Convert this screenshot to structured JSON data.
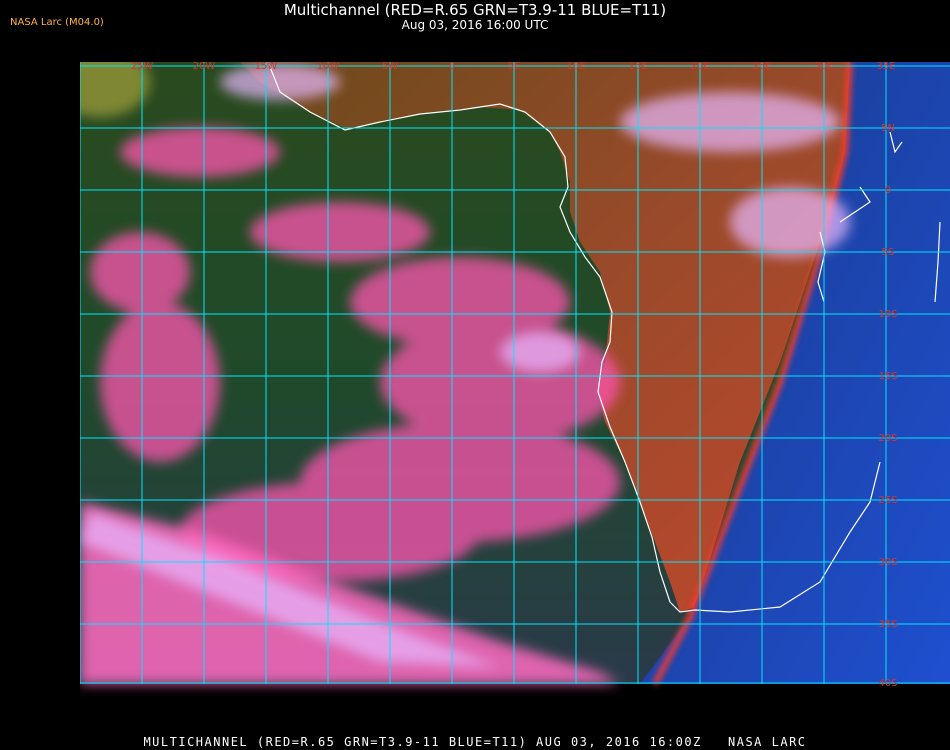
{
  "header": {
    "title": "Multichannel (RED=R.65 GRN=T3.9-11 BLUE=T11)",
    "subtitle": "Aug 03, 2016 16:00 UTC",
    "source_tag": "NASA Larc (M04.0)"
  },
  "footer": {
    "text": "MULTICHANNEL (RED=R.65 GRN=T3.9-11 BLUE=T11) AUG 03, 2016 16:00Z   NASA LARC"
  },
  "map": {
    "longitude_labels": [
      "25W",
      "20W",
      "15W",
      "10W",
      "5W",
      "0",
      "5E",
      "10E",
      "15E",
      "20E",
      "25E",
      "30E",
      "35E"
    ],
    "latitude_labels": [
      "5N",
      "0",
      "5S",
      "10S",
      "15S",
      "20S",
      "25S",
      "30S",
      "35S",
      "40S"
    ],
    "colors": {
      "grid": "#00e5ff",
      "coastline": "#ffffff",
      "labels": "#d8352a",
      "ocean": "#1f4a2a",
      "cloud": "#ff55b0",
      "high_cloud": "#e8b8ff",
      "land_day": "#b84a2a",
      "night_side": "#1b3d9a"
    }
  }
}
